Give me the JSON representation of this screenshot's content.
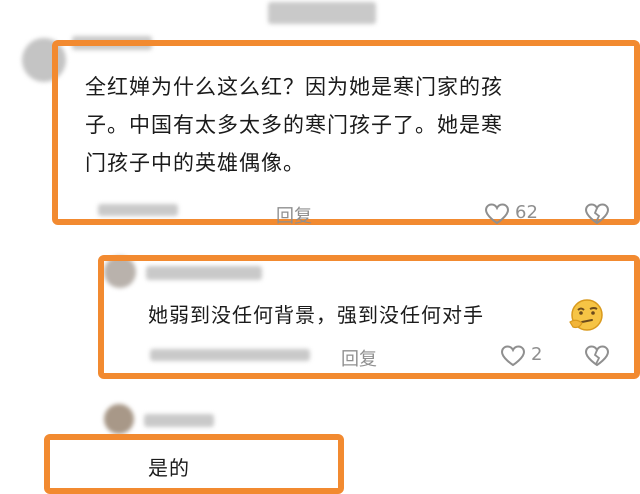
{
  "comments": [
    {
      "text_line1": "全红婵为什么这么红？因为她是寒门家的孩",
      "text_line2": "子。中国有太多太多的寒门孩子了。她是寒",
      "text_line3": "门孩子中的英雄偶像。",
      "reply_label": "回复",
      "like_count": "62"
    },
    {
      "text": "她弱到没任何背景，强到没任何对手",
      "reply_label": "回复",
      "like_count": "2"
    },
    {
      "text": "是的"
    }
  ],
  "icons": {
    "like": "heart-outline-icon",
    "dislike": "broken-heart-icon",
    "emoji": "thinking-face-emoji"
  },
  "colors": {
    "highlight_border": "#f28a30"
  }
}
